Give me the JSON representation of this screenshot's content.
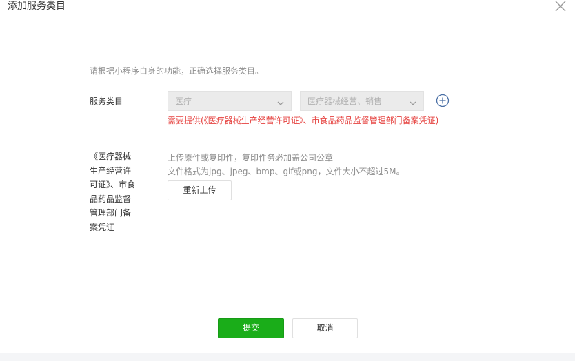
{
  "dialog": {
    "title": "添加服务类目",
    "close_icon": "close-icon"
  },
  "form": {
    "hint": "请根据小程序自身的功能，正确选择服务类目。",
    "category_label": "服务类目",
    "primary_select": {
      "value": "医疗",
      "icon": "chevron-down-icon"
    },
    "secondary_select": {
      "value": "医疗器械经营、销售",
      "icon": "chevron-down-icon"
    },
    "add_icon": "plus-circle-icon",
    "requirement_note": "需要提供(《医疗器械生产经营许可证》、市食品药品监督管理部门备案凭证)",
    "document_label": "《医疗器械生产经营许可证》、市食品药品监督管理部门备案凭证",
    "upload_notes": [
      "上传原件或复印件，复印件务必加盖公司公章",
      "文件格式为jpg、jpeg、bmp、gif或png，文件大小不超过5M。"
    ],
    "reupload_label": "重新上传"
  },
  "footer": {
    "submit_label": "提交",
    "cancel_label": "取消"
  },
  "colors": {
    "primary_green": "#1aad19",
    "warning_red": "#e64340",
    "hint_gray": "#8d8d8d"
  }
}
